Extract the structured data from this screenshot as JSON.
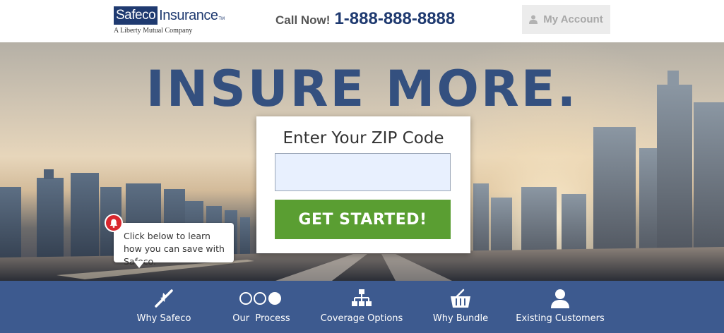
{
  "header": {
    "logo": {
      "brand_boxed": "Safeco",
      "brand_rest": "Insurance",
      "trademark": "TM",
      "tagline": "A Liberty Mutual Company"
    },
    "call": {
      "label": "Call Now!",
      "phone": "1-888-888-8888"
    },
    "account_button": {
      "label": "My Account",
      "icon": "user-icon"
    }
  },
  "hero": {
    "headline": "INSURE MORE.",
    "zip_form": {
      "title": "Enter Your ZIP Code",
      "input_value": "",
      "input_placeholder": "",
      "button_label": "GET STARTED!"
    },
    "tooltip": {
      "icon": "bell-icon",
      "text": "Click below to learn how you can save with Safeco."
    }
  },
  "nav": {
    "items": [
      {
        "label": "Why Safeco",
        "icon": "arrows-icon"
      },
      {
        "label": "Our  Process",
        "icon": "process-circles-icon"
      },
      {
        "label": "Coverage Options",
        "icon": "org-chart-icon"
      },
      {
        "label": "Why Bundle",
        "icon": "basket-icon"
      },
      {
        "label": "Existing Customers",
        "icon": "user-icon"
      }
    ]
  },
  "colors": {
    "brand_navy": "#1f3a70",
    "headline": "#34507f",
    "cta_green": "#5a9e32",
    "nav_bg": "#3d5a8f",
    "alert_red": "#d9272e"
  }
}
